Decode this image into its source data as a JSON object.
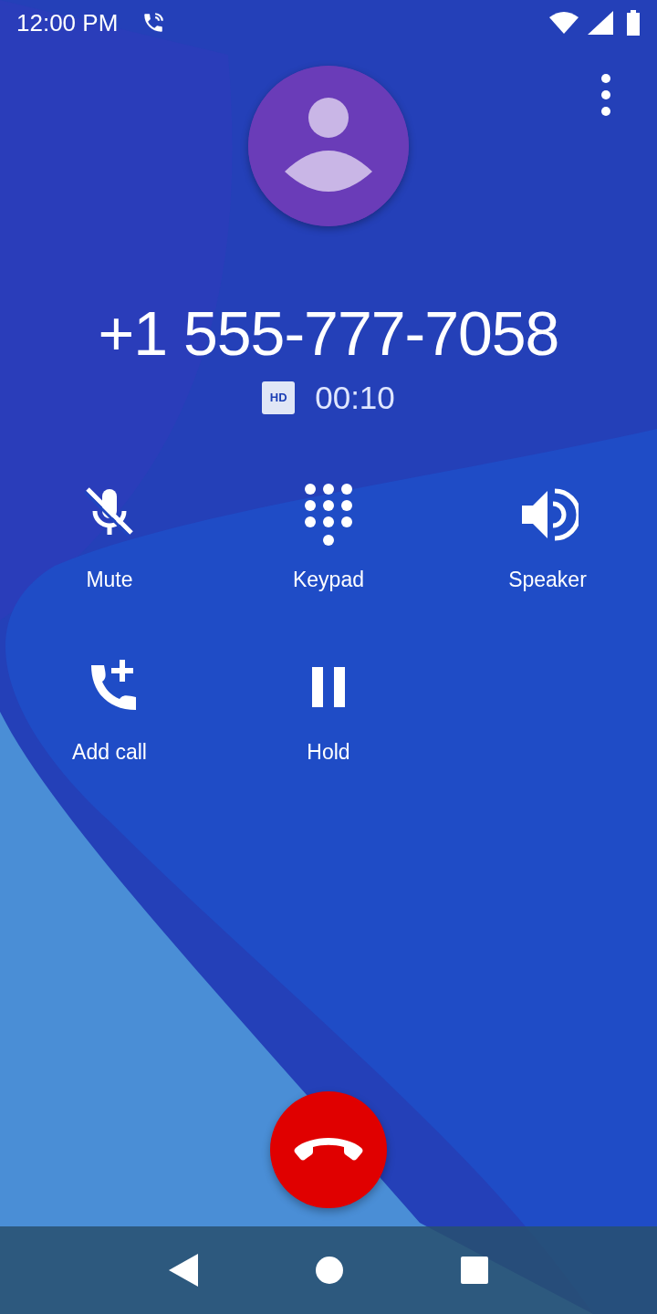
{
  "status_bar": {
    "time": "12:00 PM"
  },
  "call": {
    "number": "+1 555-777-7058",
    "hd_badge": "HD",
    "duration": "00:10"
  },
  "actions": [
    {
      "kind": "mute",
      "label": "Mute"
    },
    {
      "kind": "keypad",
      "label": "Keypad"
    },
    {
      "kind": "speaker",
      "label": "Speaker"
    },
    {
      "kind": "add_call",
      "label": "Add call"
    },
    {
      "kind": "hold",
      "label": "Hold"
    }
  ]
}
